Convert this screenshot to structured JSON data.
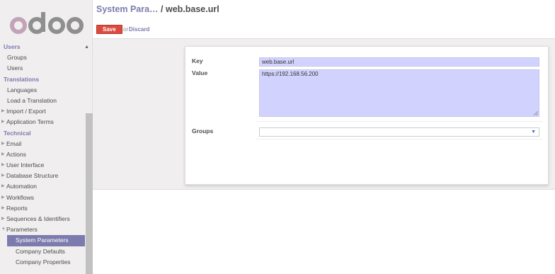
{
  "logo": {
    "text": "odoo"
  },
  "sidebar": {
    "users_category": "Users",
    "users_items": [
      "Groups",
      "Users"
    ],
    "translations_category": "Translations",
    "translations_items": [
      "Languages",
      "Load a Translation"
    ],
    "parent_items_a": [
      "Import / Export",
      "Application Terms"
    ],
    "technical_category": "Technical",
    "technical_items": [
      "Email",
      "Actions",
      "User Interface",
      "Database Structure",
      "Automation",
      "Workflows",
      "Reports",
      "Sequences & Identifiers",
      "Parameters"
    ],
    "parameters_children": [
      "System Parameters",
      "Company Defaults",
      "Company Properties"
    ],
    "active_item": "System Parameters"
  },
  "header": {
    "breadcrumb_parent": "System Para…",
    "breadcrumb_sep": " / ",
    "breadcrumb_current": "web.base.url",
    "save_label": "Save",
    "or_label": "or",
    "discard_label": "Discard"
  },
  "form": {
    "key_label": "Key",
    "key_value": "web.base.url",
    "value_label": "Value",
    "value_value": "https://192.168.56.200",
    "groups_label": "Groups",
    "groups_value": ""
  },
  "colors": {
    "accent": "#7c7bad",
    "save": "#dc4a3e",
    "field_bg": "#d2d2ff"
  }
}
